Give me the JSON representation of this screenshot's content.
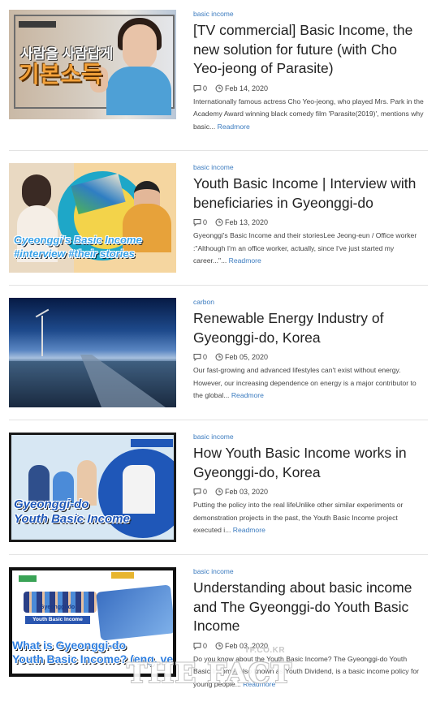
{
  "posts": [
    {
      "category": "basic income",
      "title": "[TV commercial] Basic Income, the new solution for future (with Cho Yeo-jeong of Parasite)",
      "comments": "0",
      "date": "Feb 14, 2020",
      "excerpt": "Internationally famous actress Cho Yeo-jeong, who played Mrs. Park in the Academy Award winning black comedy film 'Parasite(2019)', mentions why basic...",
      "more": "Readmore",
      "thumb_text": [
        "사람을 사람답게",
        "기본소득"
      ]
    },
    {
      "category": "basic income",
      "title": "Youth Basic Income | Interview with beneficiaries in Gyeonggi-do",
      "comments": "0",
      "date": "Feb 13, 2020",
      "excerpt": "Gyeonggi's Basic Income and their storiesLee Jeong-eun / Office worker :\"Although I'm an office worker, actually, since I've just started my career...\"...",
      "more": "Readmore",
      "thumb_text": [
        "Gyeonggi's Basic Income",
        "#interview #their stories"
      ]
    },
    {
      "category": "carbon",
      "title": "Renewable Energy Industry of Gyeonggi-do, Korea",
      "comments": "0",
      "date": "Feb 05, 2020",
      "excerpt": "Our fast-growing and advanced lifestyles can't exist without energy. However, our increasing dependence on energy is a major contributor to the global...",
      "more": "Readmore"
    },
    {
      "category": "basic income",
      "title": "How Youth Basic Income works in Gyeonggi-do, Korea",
      "comments": "0",
      "date": "Feb 03, 2020",
      "excerpt": "Putting the policy into the real lifeUnlike other similar experiments or demonstration projects in the past, the Youth Basic Income project executed i...",
      "more": "Readmore",
      "thumb_text": [
        "Gyeonggi-do",
        "Youth Basic Income"
      ]
    },
    {
      "category": "basic income",
      "title": "Understanding about basic income and The Gyeonggi-do Youth Basic Income",
      "comments": "0",
      "date": "Feb 03, 2020",
      "excerpt": "Do you know about the Youth Basic Income? The Gyeonggi-do Youth Basic Income, also known as Youth Dividend, is a basic income policy for young people...",
      "more": "Readmore",
      "thumb_text": [
        "Gyeonggi-do",
        "Youth Basic Income",
        "What is Gyeonggi-do",
        "Youth Basic Income? (eng. ver)"
      ]
    }
  ],
  "icons": {
    "comment": "comment-icon",
    "date": "clock-icon"
  },
  "colors": {
    "accent": "#3b7bbf",
    "text": "#222222",
    "meta": "#444444",
    "divider": "#e3e3e3"
  },
  "watermark": {
    "url": "TF.CO.KR",
    "brand": "THE FACT"
  }
}
